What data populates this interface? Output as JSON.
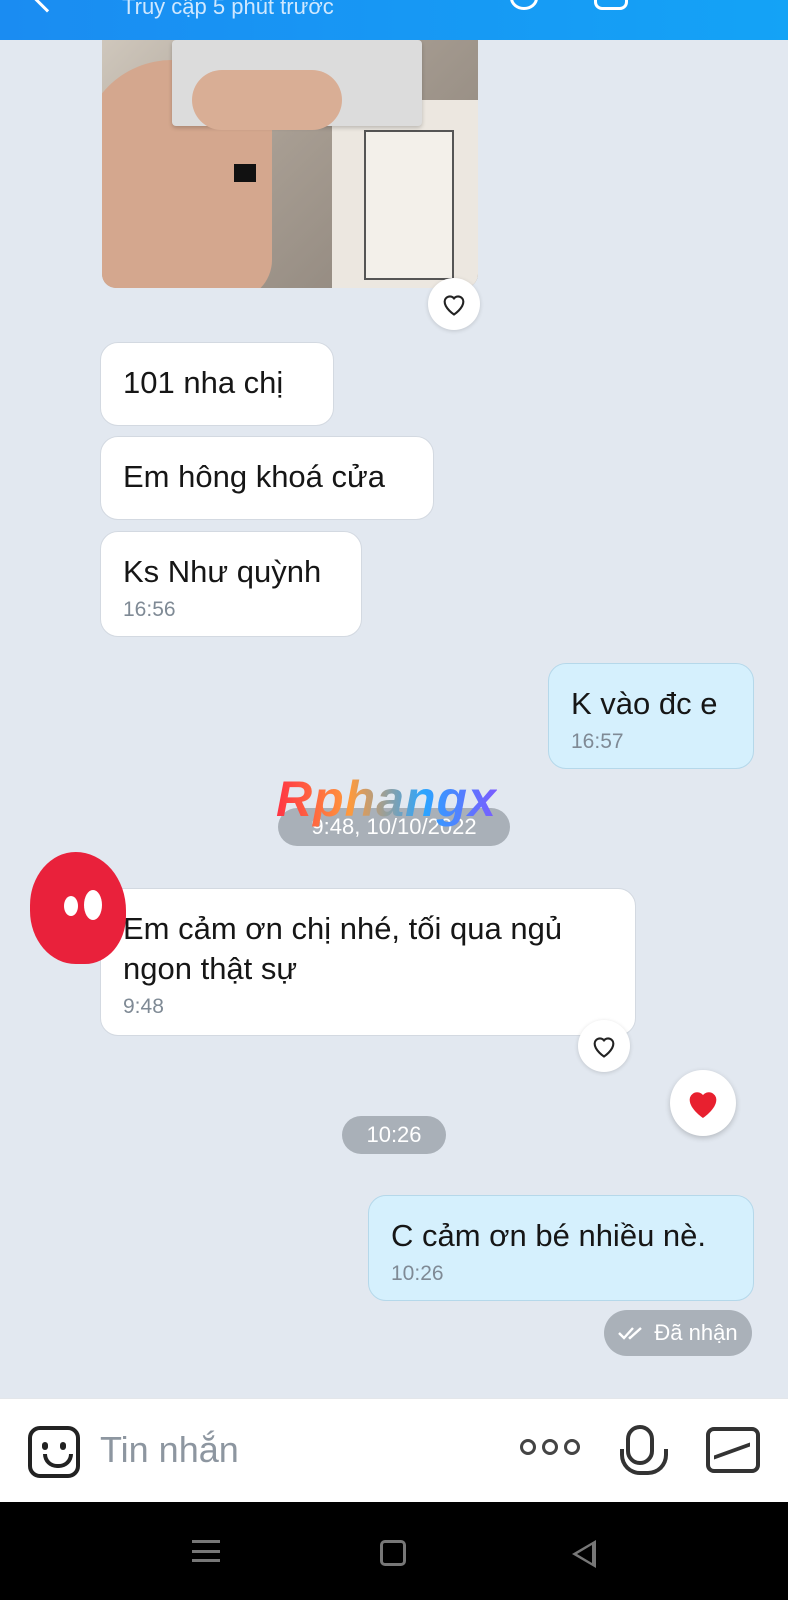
{
  "header": {
    "subtitle": "Truy cập 5 phút trước"
  },
  "messages": [
    {
      "text": "101 nha chị",
      "time": ""
    },
    {
      "text": "Em hông khoá cửa",
      "time": ""
    },
    {
      "text": "Ks Như quỳnh",
      "time": "16:56"
    },
    {
      "text": "K vào đc e",
      "time": "16:57"
    },
    {
      "text": "Em cảm ơn chị nhé, tối qua ngủ ngon thật sự",
      "time": "9:48"
    },
    {
      "text": "C cảm ơn bé nhiều nè.",
      "time": "10:26"
    }
  ],
  "separators": {
    "date_1": "9:48, 10/10/2022",
    "time_1": "10:26"
  },
  "watermark": "Rphangx",
  "status": {
    "received": "Đã nhận"
  },
  "composer": {
    "placeholder": "Tin nhắn"
  },
  "icons": {
    "back": "back-icon",
    "heart_outline": "heart-outline-icon",
    "heart_filled": "heart-filled-icon",
    "emoji": "emoji-icon",
    "more": "more-icon",
    "mic": "mic-icon",
    "image": "image-icon",
    "double_check": "double-check-icon"
  },
  "colors": {
    "header": "#1a8cf2",
    "my_bubble": "#d5f0fd",
    "their_bubble": "#ffffff",
    "heart": "#e8202f"
  }
}
